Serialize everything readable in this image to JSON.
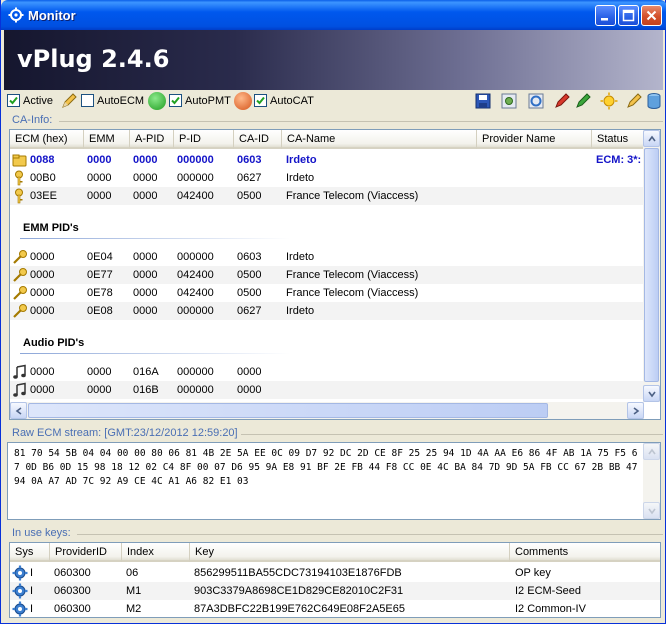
{
  "window": {
    "title": "Monitor",
    "brand": "vPlug 2.4.6"
  },
  "toolbar": {
    "active_label": "Active",
    "autoecm_label": "AutoECM",
    "autopmt_label": "AutoPMT",
    "autocat_label": "AutoCAT",
    "active_checked": true,
    "autoecm_checked": false,
    "autopmt_checked": true,
    "autocat_checked": true
  },
  "ca_info": {
    "group_label": "CA-Info:",
    "columns": [
      "ECM (hex)",
      "EMM",
      "A-PID",
      "P-ID",
      "CA-ID",
      "CA-Name",
      "Provider Name",
      "Status"
    ],
    "ecm_rows": [
      {
        "ecm": "0088",
        "emm": "0000",
        "apid": "0000",
        "pid": "000000",
        "caid": "0603",
        "caname": "Irdeto",
        "provider": "",
        "status": "ECM: 3*:",
        "highlight": true
      },
      {
        "ecm": "00B0",
        "emm": "0000",
        "apid": "0000",
        "pid": "000000",
        "caid": "0627",
        "caname": "Irdeto",
        "provider": "",
        "status": "",
        "highlight": false
      },
      {
        "ecm": "03EE",
        "emm": "0000",
        "apid": "0000",
        "pid": "042400",
        "caid": "0500",
        "caname": "France Telecom (Viaccess)",
        "provider": "",
        "status": "",
        "highlight": false
      }
    ],
    "emm_section_title": "EMM PID's",
    "emm_rows": [
      {
        "ecm": "0000",
        "emm": "0E04",
        "apid": "0000",
        "pid": "000000",
        "caid": "0603",
        "caname": "Irdeto"
      },
      {
        "ecm": "0000",
        "emm": "0E77",
        "apid": "0000",
        "pid": "042400",
        "caid": "0500",
        "caname": "France Telecom (Viaccess)"
      },
      {
        "ecm": "0000",
        "emm": "0E78",
        "apid": "0000",
        "pid": "042400",
        "caid": "0500",
        "caname": "France Telecom (Viaccess)"
      },
      {
        "ecm": "0000",
        "emm": "0E08",
        "apid": "0000",
        "pid": "000000",
        "caid": "0627",
        "caname": "Irdeto"
      }
    ],
    "audio_section_title": "Audio PID's",
    "audio_rows": [
      {
        "ecm": "0000",
        "emm": "0000",
        "apid": "016A",
        "pid": "000000",
        "caid": "0000"
      },
      {
        "ecm": "0000",
        "emm": "0000",
        "apid": "016B",
        "pid": "000000",
        "caid": "0000"
      }
    ]
  },
  "raw_ecm": {
    "group_label": "Raw ECM stream: [GMT:23/12/2012 12:59:20]",
    "text": "81 70 54 5B 04 04 00 00 80 06 81 4B 2E 5A EE 0C 09 D7 92 DC 2D CE 8F 25 25 94 1D 4A AA E6 86 4F AB 1A 75 F5 67 0D B6 0D 15 98 18 12 02 C4 8F 00 07 D6 95 9A E8 91 BF 2E FB 44 F8 CC 0E 4C BA 84 7D 9D 5A FB CC 67 2B BB 47 94 0A A7 AD 7C 92 A9 CE 4C A1 A6 82 E1 03"
  },
  "keys": {
    "group_label": "In use keys:",
    "columns": [
      "Sys",
      "ProviderID",
      "Index",
      "Key",
      "Comments"
    ],
    "rows": [
      {
        "sys": "I",
        "provider": "060300",
        "index": "06",
        "key": "856299511BA55CDC73194103E1876FDB",
        "comment": "OP key"
      },
      {
        "sys": "I",
        "provider": "060300",
        "index": "M1",
        "key": "903C3379A8698CE1D829CE82010C2F31",
        "comment": "I2 ECM-Seed"
      },
      {
        "sys": "I",
        "provider": "060300",
        "index": "M2",
        "key": "87A3DBFC22B199E762C649E08F2A5E65",
        "comment": "I2 Common-IV"
      }
    ]
  },
  "colors": {
    "titlebar": "#0058EE",
    "highlight_text": "#1414C8",
    "group_label": "#4A6FB4"
  }
}
